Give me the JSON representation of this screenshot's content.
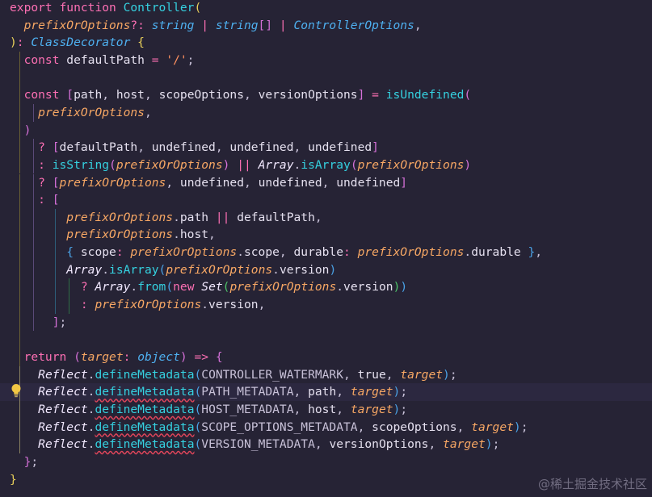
{
  "editor": {
    "watermark": "@稀土掘金技术社区",
    "colors": {
      "background": "#262335",
      "keyword": "#fc6fb3",
      "function": "#35d1e0",
      "parameter": "#f7a764",
      "type": "#4eb0f0",
      "string": "#ff9160"
    },
    "lines": [
      [
        {
          "t": "export ",
          "c": "kw"
        },
        {
          "t": "function ",
          "c": "kw"
        },
        {
          "t": "Controller",
          "c": "fn"
        },
        {
          "t": "(",
          "c": "br-y"
        }
      ],
      [
        {
          "t": "  "
        },
        {
          "t": "prefixOrOptions",
          "c": "prm"
        },
        {
          "t": "?: ",
          "c": "op"
        },
        {
          "t": "string",
          "c": "ty"
        },
        {
          "t": " | ",
          "c": "op"
        },
        {
          "t": "string",
          "c": "ty"
        },
        {
          "t": "[]",
          "c": "br-p"
        },
        {
          "t": " | ",
          "c": "op"
        },
        {
          "t": "ControllerOptions",
          "c": "ty"
        },
        {
          "t": ",",
          "c": "pn"
        }
      ],
      [
        {
          "t": ")",
          "c": "br-y"
        },
        {
          "t": ": ",
          "c": "op"
        },
        {
          "t": "ClassDecorator",
          "c": "ty"
        },
        {
          "t": " {",
          "c": "br-y"
        }
      ],
      [
        {
          "t": "  "
        },
        {
          "t": "const ",
          "c": "kw"
        },
        {
          "t": "defaultPath",
          "c": "var"
        },
        {
          "t": " = ",
          "c": "op"
        },
        {
          "t": "'/'",
          "c": "str"
        },
        {
          "t": ";",
          "c": "pn"
        }
      ],
      [],
      [
        {
          "t": "  "
        },
        {
          "t": "const ",
          "c": "kw"
        },
        {
          "t": "[",
          "c": "br-p"
        },
        {
          "t": "path",
          "c": "var"
        },
        {
          "t": ", ",
          "c": "pn"
        },
        {
          "t": "host",
          "c": "var"
        },
        {
          "t": ", ",
          "c": "pn"
        },
        {
          "t": "scopeOptions",
          "c": "var"
        },
        {
          "t": ", ",
          "c": "pn"
        },
        {
          "t": "versionOptions",
          "c": "var"
        },
        {
          "t": "]",
          "c": "br-p"
        },
        {
          "t": " = ",
          "c": "op"
        },
        {
          "t": "isUndefined",
          "c": "fn"
        },
        {
          "t": "(",
          "c": "br-p"
        }
      ],
      [
        {
          "t": "    "
        },
        {
          "t": "prefixOrOptions",
          "c": "prm"
        },
        {
          "t": ",",
          "c": "pn"
        }
      ],
      [
        {
          "t": "  "
        },
        {
          "t": ")",
          "c": "br-p"
        }
      ],
      [
        {
          "t": "    "
        },
        {
          "t": "? ",
          "c": "op"
        },
        {
          "t": "[",
          "c": "br-p"
        },
        {
          "t": "defaultPath",
          "c": "var"
        },
        {
          "t": ", ",
          "c": "pn"
        },
        {
          "t": "undefined",
          "c": "var"
        },
        {
          "t": ", ",
          "c": "pn"
        },
        {
          "t": "undefined",
          "c": "var"
        },
        {
          "t": ", ",
          "c": "pn"
        },
        {
          "t": "undefined",
          "c": "var"
        },
        {
          "t": "]",
          "c": "br-p"
        }
      ],
      [
        {
          "t": "    "
        },
        {
          "t": ": ",
          "c": "op"
        },
        {
          "t": "isString",
          "c": "fn"
        },
        {
          "t": "(",
          "c": "br-p"
        },
        {
          "t": "prefixOrOptions",
          "c": "prm"
        },
        {
          "t": ")",
          "c": "br-p"
        },
        {
          "t": " || ",
          "c": "op"
        },
        {
          "t": "Array",
          "c": "cls"
        },
        {
          "t": ".",
          "c": "pn"
        },
        {
          "t": "isArray",
          "c": "fn"
        },
        {
          "t": "(",
          "c": "br-p"
        },
        {
          "t": "prefixOrOptions",
          "c": "prm"
        },
        {
          "t": ")",
          "c": "br-p"
        }
      ],
      [
        {
          "t": "    "
        },
        {
          "t": "? ",
          "c": "op"
        },
        {
          "t": "[",
          "c": "br-p"
        },
        {
          "t": "prefixOrOptions",
          "c": "prm"
        },
        {
          "t": ", ",
          "c": "pn"
        },
        {
          "t": "undefined",
          "c": "var"
        },
        {
          "t": ", ",
          "c": "pn"
        },
        {
          "t": "undefined",
          "c": "var"
        },
        {
          "t": ", ",
          "c": "pn"
        },
        {
          "t": "undefined",
          "c": "var"
        },
        {
          "t": "]",
          "c": "br-p"
        }
      ],
      [
        {
          "t": "    "
        },
        {
          "t": ": ",
          "c": "op"
        },
        {
          "t": "[",
          "c": "br-p"
        }
      ],
      [
        {
          "t": "        "
        },
        {
          "t": "prefixOrOptions",
          "c": "prm"
        },
        {
          "t": ".",
          "c": "pn"
        },
        {
          "t": "path",
          "c": "var"
        },
        {
          "t": " || ",
          "c": "op"
        },
        {
          "t": "defaultPath",
          "c": "var"
        },
        {
          "t": ",",
          "c": "pn"
        }
      ],
      [
        {
          "t": "        "
        },
        {
          "t": "prefixOrOptions",
          "c": "prm"
        },
        {
          "t": ".",
          "c": "pn"
        },
        {
          "t": "host",
          "c": "var"
        },
        {
          "t": ",",
          "c": "pn"
        }
      ],
      [
        {
          "t": "        "
        },
        {
          "t": "{",
          "c": "br-b"
        },
        {
          "t": " scope",
          "c": "var"
        },
        {
          "t": ": ",
          "c": "op"
        },
        {
          "t": "prefixOrOptions",
          "c": "prm"
        },
        {
          "t": ".",
          "c": "pn"
        },
        {
          "t": "scope",
          "c": "var"
        },
        {
          "t": ", ",
          "c": "pn"
        },
        {
          "t": "durable",
          "c": "var"
        },
        {
          "t": ": ",
          "c": "op"
        },
        {
          "t": "prefixOrOptions",
          "c": "prm"
        },
        {
          "t": ".",
          "c": "pn"
        },
        {
          "t": "durable",
          "c": "var"
        },
        {
          "t": " }",
          "c": "br-b"
        },
        {
          "t": ",",
          "c": "pn"
        }
      ],
      [
        {
          "t": "        "
        },
        {
          "t": "Array",
          "c": "cls"
        },
        {
          "t": ".",
          "c": "pn"
        },
        {
          "t": "isArray",
          "c": "fn"
        },
        {
          "t": "(",
          "c": "br-b"
        },
        {
          "t": "prefixOrOptions",
          "c": "prm"
        },
        {
          "t": ".",
          "c": "pn"
        },
        {
          "t": "version",
          "c": "var"
        },
        {
          "t": ")",
          "c": "br-b"
        }
      ],
      [
        {
          "t": "          "
        },
        {
          "t": "? ",
          "c": "op"
        },
        {
          "t": "Array",
          "c": "cls"
        },
        {
          "t": ".",
          "c": "pn"
        },
        {
          "t": "from",
          "c": "fn"
        },
        {
          "t": "(",
          "c": "br-b"
        },
        {
          "t": "new ",
          "c": "kw"
        },
        {
          "t": "Set",
          "c": "cls"
        },
        {
          "t": "(",
          "c": "br-g"
        },
        {
          "t": "prefixOrOptions",
          "c": "prm"
        },
        {
          "t": ".",
          "c": "pn"
        },
        {
          "t": "version",
          "c": "var"
        },
        {
          "t": ")",
          "c": "br-g"
        },
        {
          "t": ")",
          "c": "br-b"
        }
      ],
      [
        {
          "t": "          "
        },
        {
          "t": ": ",
          "c": "op"
        },
        {
          "t": "prefixOrOptions",
          "c": "prm"
        },
        {
          "t": ".",
          "c": "pn"
        },
        {
          "t": "version",
          "c": "var"
        },
        {
          "t": ",",
          "c": "pn"
        }
      ],
      [
        {
          "t": "      "
        },
        {
          "t": "]",
          "c": "br-p"
        },
        {
          "t": ";",
          "c": "pn"
        }
      ],
      [],
      [
        {
          "t": "  "
        },
        {
          "t": "return ",
          "c": "kw"
        },
        {
          "t": "(",
          "c": "br-p"
        },
        {
          "t": "target",
          "c": "prm"
        },
        {
          "t": ": ",
          "c": "op"
        },
        {
          "t": "object",
          "c": "ty"
        },
        {
          "t": ")",
          "c": "br-p"
        },
        {
          "t": " => ",
          "c": "op"
        },
        {
          "t": "{",
          "c": "br-p"
        }
      ],
      [
        {
          "t": "    "
        },
        {
          "t": "Reflect",
          "c": "cls"
        },
        {
          "t": ".",
          "c": "pn"
        },
        {
          "t": "defineMetadata",
          "c": "fn"
        },
        {
          "t": "(",
          "c": "br-b"
        },
        {
          "t": "CONTROLLER_WATERMARK",
          "c": "con"
        },
        {
          "t": ", ",
          "c": "pn"
        },
        {
          "t": "true",
          "c": "var"
        },
        {
          "t": ", ",
          "c": "pn"
        },
        {
          "t": "target",
          "c": "prm"
        },
        {
          "t": ")",
          "c": "br-b"
        },
        {
          "t": ";",
          "c": "pn"
        }
      ],
      [
        {
          "t": "    "
        },
        {
          "t": "Reflect",
          "c": "cls"
        },
        {
          "t": ".",
          "c": "pn"
        },
        {
          "t": "defineMetadata",
          "c": "fn-u"
        },
        {
          "t": "(",
          "c": "br-b"
        },
        {
          "t": "PATH_METADATA",
          "c": "con"
        },
        {
          "t": ", ",
          "c": "pn"
        },
        {
          "t": "path",
          "c": "var"
        },
        {
          "t": ", ",
          "c": "pn"
        },
        {
          "t": "target",
          "c": "prm"
        },
        {
          "t": ")",
          "c": "br-b"
        },
        {
          "t": ";",
          "c": "pn"
        }
      ],
      [
        {
          "t": "    "
        },
        {
          "t": "Reflect",
          "c": "cls"
        },
        {
          "t": ".",
          "c": "pn"
        },
        {
          "t": "defineMetadata",
          "c": "fn-u"
        },
        {
          "t": "(",
          "c": "br-b"
        },
        {
          "t": "HOST_METADATA",
          "c": "con"
        },
        {
          "t": ", ",
          "c": "pn"
        },
        {
          "t": "host",
          "c": "var"
        },
        {
          "t": ", ",
          "c": "pn"
        },
        {
          "t": "target",
          "c": "prm"
        },
        {
          "t": ")",
          "c": "br-b"
        },
        {
          "t": ";",
          "c": "pn"
        }
      ],
      [
        {
          "t": "    "
        },
        {
          "t": "Reflect",
          "c": "cls"
        },
        {
          "t": ".",
          "c": "pn"
        },
        {
          "t": "defineMetadata",
          "c": "fn-u"
        },
        {
          "t": "(",
          "c": "br-b"
        },
        {
          "t": "SCOPE_OPTIONS_METADATA",
          "c": "con"
        },
        {
          "t": ", ",
          "c": "pn"
        },
        {
          "t": "scopeOptions",
          "c": "var"
        },
        {
          "t": ", ",
          "c": "pn"
        },
        {
          "t": "target",
          "c": "prm"
        },
        {
          "t": ")",
          "c": "br-b"
        },
        {
          "t": ";",
          "c": "pn"
        }
      ],
      [
        {
          "t": "    "
        },
        {
          "t": "Reflect",
          "c": "cls"
        },
        {
          "t": ".",
          "c": "pn"
        },
        {
          "t": "defineMetadata",
          "c": "fn-u"
        },
        {
          "t": "(",
          "c": "br-b"
        },
        {
          "t": "VERSION_METADATA",
          "c": "con"
        },
        {
          "t": ", ",
          "c": "pn"
        },
        {
          "t": "versionOptions",
          "c": "var"
        },
        {
          "t": ", ",
          "c": "pn"
        },
        {
          "t": "target",
          "c": "prm"
        },
        {
          "t": ")",
          "c": "br-b"
        },
        {
          "t": ";",
          "c": "pn"
        }
      ],
      [
        {
          "t": "  "
        },
        {
          "t": "}",
          "c": "br-p"
        },
        {
          "t": ";",
          "c": "pn"
        }
      ],
      [
        {
          "t": "}",
          "c": "br-y"
        }
      ]
    ]
  }
}
